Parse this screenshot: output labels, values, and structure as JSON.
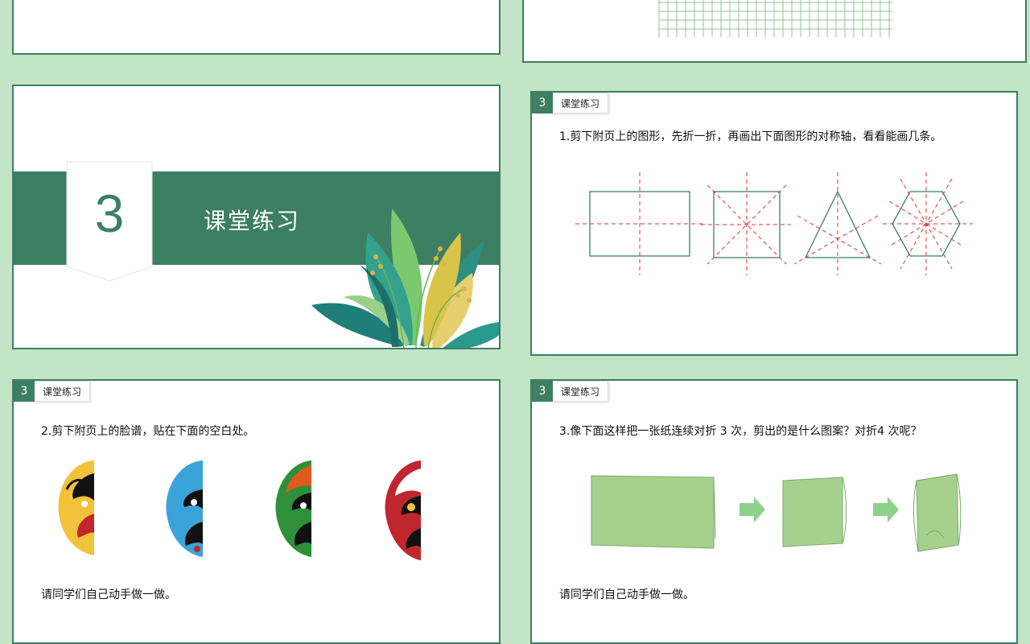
{
  "section": {
    "number": "3",
    "title": "课堂练习"
  },
  "slide_header": {
    "number": "3",
    "label": "课堂练习"
  },
  "exercise1": {
    "question": "1.剪下附页上的图形，先折一折，再画出下面图形的对称轴，看看能画几条。",
    "shapes": [
      "rectangle",
      "square",
      "triangle",
      "hexagon"
    ]
  },
  "exercise2": {
    "question": "2.剪下附页上的脸谱，贴在下面的空白处。",
    "note": "请同学们自己动手做一做。",
    "masks": [
      "mask-yellow",
      "mask-blue",
      "mask-green",
      "mask-red"
    ]
  },
  "exercise3": {
    "question": "3.像下面这样把一张纸连续对折 3 次，剪出的是什么图案？对折4 次呢？",
    "note": "请同学们自己动手做一做。"
  },
  "colors": {
    "background": "#c3e4c6",
    "accent": "#3c7f62",
    "axis": "#e0312f",
    "paper": "#a6d18d"
  }
}
